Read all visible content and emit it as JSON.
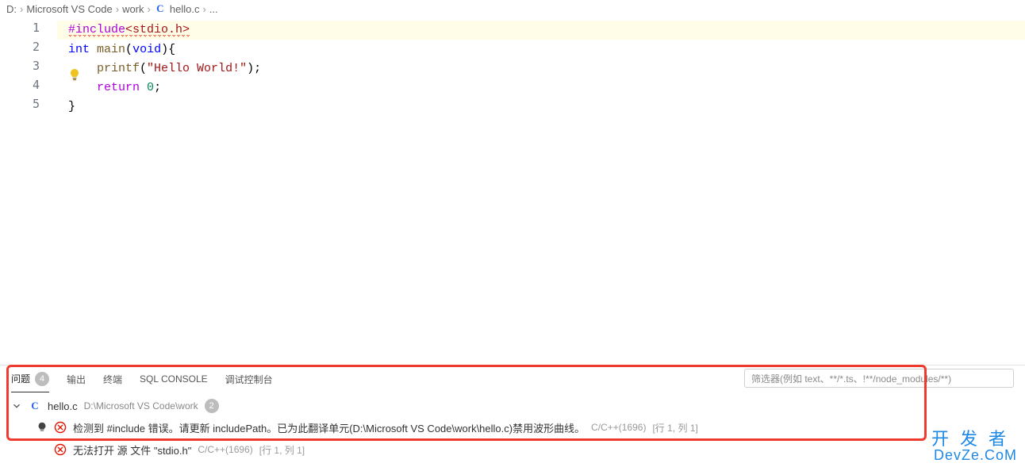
{
  "breadcrumb": {
    "items": [
      "D:",
      "Microsoft VS Code",
      "work",
      "hello.c",
      "..."
    ],
    "file_icon": "C"
  },
  "editor": {
    "lines": {
      "l1_directive": "#include",
      "l1_header": "<stdio.h>",
      "l2_kw": "int",
      "l2_fn": "main",
      "l2_sig1": "(",
      "l2_void": "void",
      "l2_sig2": "){",
      "l3_indent": "    ",
      "l3_fn": "printf",
      "l3_p1": "(",
      "l3_str": "\"Hello World!\"",
      "l3_p2": ");",
      "l4_indent": "    ",
      "l4_kw": "return",
      "l4_sp": " ",
      "l4_num": "0",
      "l4_p": ";",
      "l5": "}"
    },
    "line_numbers": [
      "1",
      "2",
      "3",
      "4",
      "5"
    ]
  },
  "panel": {
    "tabs": {
      "problems": "问题",
      "problems_count": "4",
      "output": "输出",
      "terminal": "终端",
      "sql": "SQL CONSOLE",
      "debug": "调试控制台"
    },
    "filter_placeholder": "筛选器(例如 text、**/*.ts、!**/node_modules/**)",
    "file": {
      "name": "hello.c",
      "path": "D:\\Microsoft VS Code\\work",
      "count": "2"
    },
    "problems": [
      {
        "message": "检测到 #include 错误。请更新 includePath。已为此翻译单元(D:\\Microsoft VS Code\\work\\hello.c)禁用波形曲线。",
        "source": "C/C++(1696)",
        "loc": "[行 1, 列 1]",
        "has_bulb": true
      },
      {
        "message": "无法打开 源 文件 \"stdio.h\"",
        "source": "C/C++(1696)",
        "loc": "[行 1, 列 1]",
        "has_bulb": false
      }
    ]
  },
  "watermark": {
    "l1": "开发者",
    "l2": "DevZe.CoM"
  }
}
